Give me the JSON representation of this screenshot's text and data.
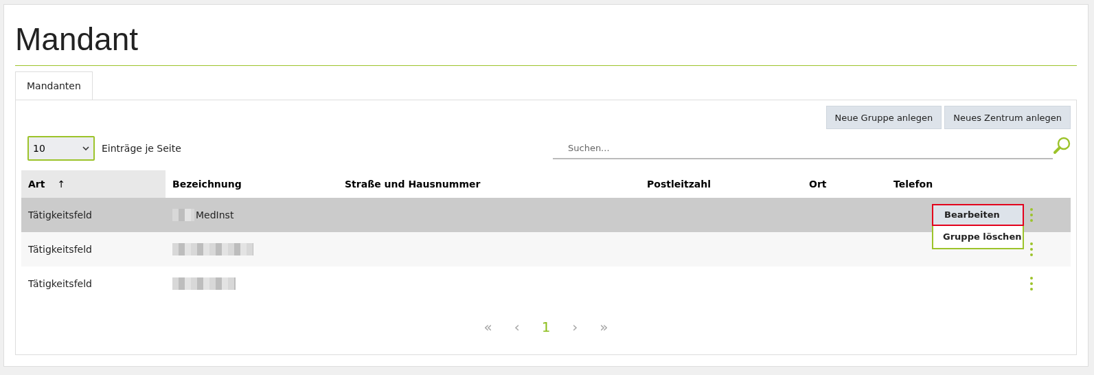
{
  "page": {
    "title": "Mandant"
  },
  "tabs": [
    {
      "label": "Mandanten",
      "selected": true
    }
  ],
  "buttons": [
    "Neue Gruppe anlegen",
    "Neues Zentrum anlegen"
  ],
  "page_size": {
    "value": "10",
    "label": "Einträge je Seite"
  },
  "search": {
    "placeholder": "Suchen..."
  },
  "table": {
    "columns": [
      {
        "label": "Art",
        "sorted": true
      },
      {
        "label": "Bezeichnung",
        "sorted": false
      },
      {
        "label": "Straße und Hausnummer",
        "sorted": false
      },
      {
        "label": "Postleitzahl",
        "sorted": false
      },
      {
        "label": "Ort",
        "sorted": false
      },
      {
        "label": "Telefon",
        "sorted": false
      }
    ],
    "sort_arrow": "↑",
    "rows": [
      {
        "art": "Tätigkeitsfeld",
        "bezeichnung": "MedInst",
        "redacted": true,
        "selected": true,
        "menu_open": true
      },
      {
        "art": "Tätigkeitsfeld",
        "redacted": true,
        "selected": false,
        "menu_open": false
      },
      {
        "art": "Tätigkeitsfeld",
        "redacted": true,
        "selected": false,
        "menu_open": false
      }
    ]
  },
  "row_menu": [
    {
      "label": "Bearbeiten",
      "selected": true
    },
    {
      "label": "Gruppe löschen",
      "selected": false
    }
  ],
  "pagination": [
    {
      "label": "«",
      "disabled": true,
      "selected": false
    },
    {
      "label": "‹",
      "disabled": true,
      "selected": false
    },
    {
      "label": "1",
      "disabled": false,
      "selected": true
    },
    {
      "label": "›",
      "disabled": true,
      "selected": false
    },
    {
      "label": "»",
      "disabled": true,
      "selected": false
    }
  ]
}
